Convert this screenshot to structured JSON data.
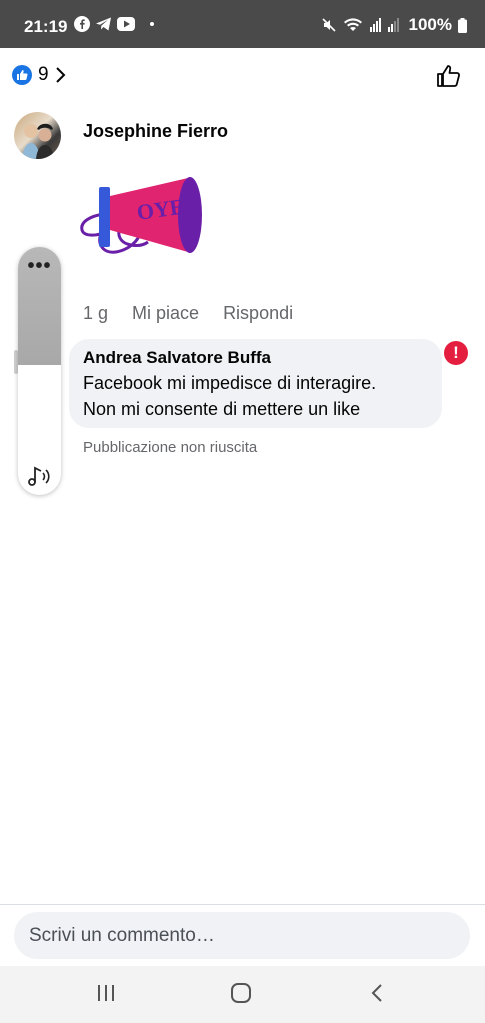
{
  "status_bar": {
    "time": "21:19",
    "battery": "100%",
    "app_icons": [
      "facebook-icon",
      "telegram-icon",
      "youtube-icon"
    ],
    "system_icons": [
      "mute-icon",
      "wifi-icon",
      "signal-icon"
    ]
  },
  "reactions": {
    "like_count": "9"
  },
  "post": {
    "author": "Josephine Fierro",
    "sticker": "OYE!"
  },
  "comment_actions": {
    "time_ago": "1 g",
    "like_label": "Mi piace",
    "reply_label": "Rispondi"
  },
  "comment": {
    "author": "Andrea Salvatore Buffa",
    "lines": [
      "Facebook mi impedisce di interagire.",
      "Non mi consente di mettere un like"
    ],
    "status": "Pubblicazione non riuscita",
    "error_symbol": "!"
  },
  "floating_panel": {
    "menu_dots": "•••"
  },
  "composer": {
    "placeholder": "Scrivi un commento…"
  },
  "colors": {
    "accent": "#1b74e4",
    "error": "#e41e3f",
    "bubble": "#f0f2f5",
    "muted_text": "#65676b",
    "sticker_pink": "#e0246f",
    "sticker_purple": "#6a1fa8"
  }
}
